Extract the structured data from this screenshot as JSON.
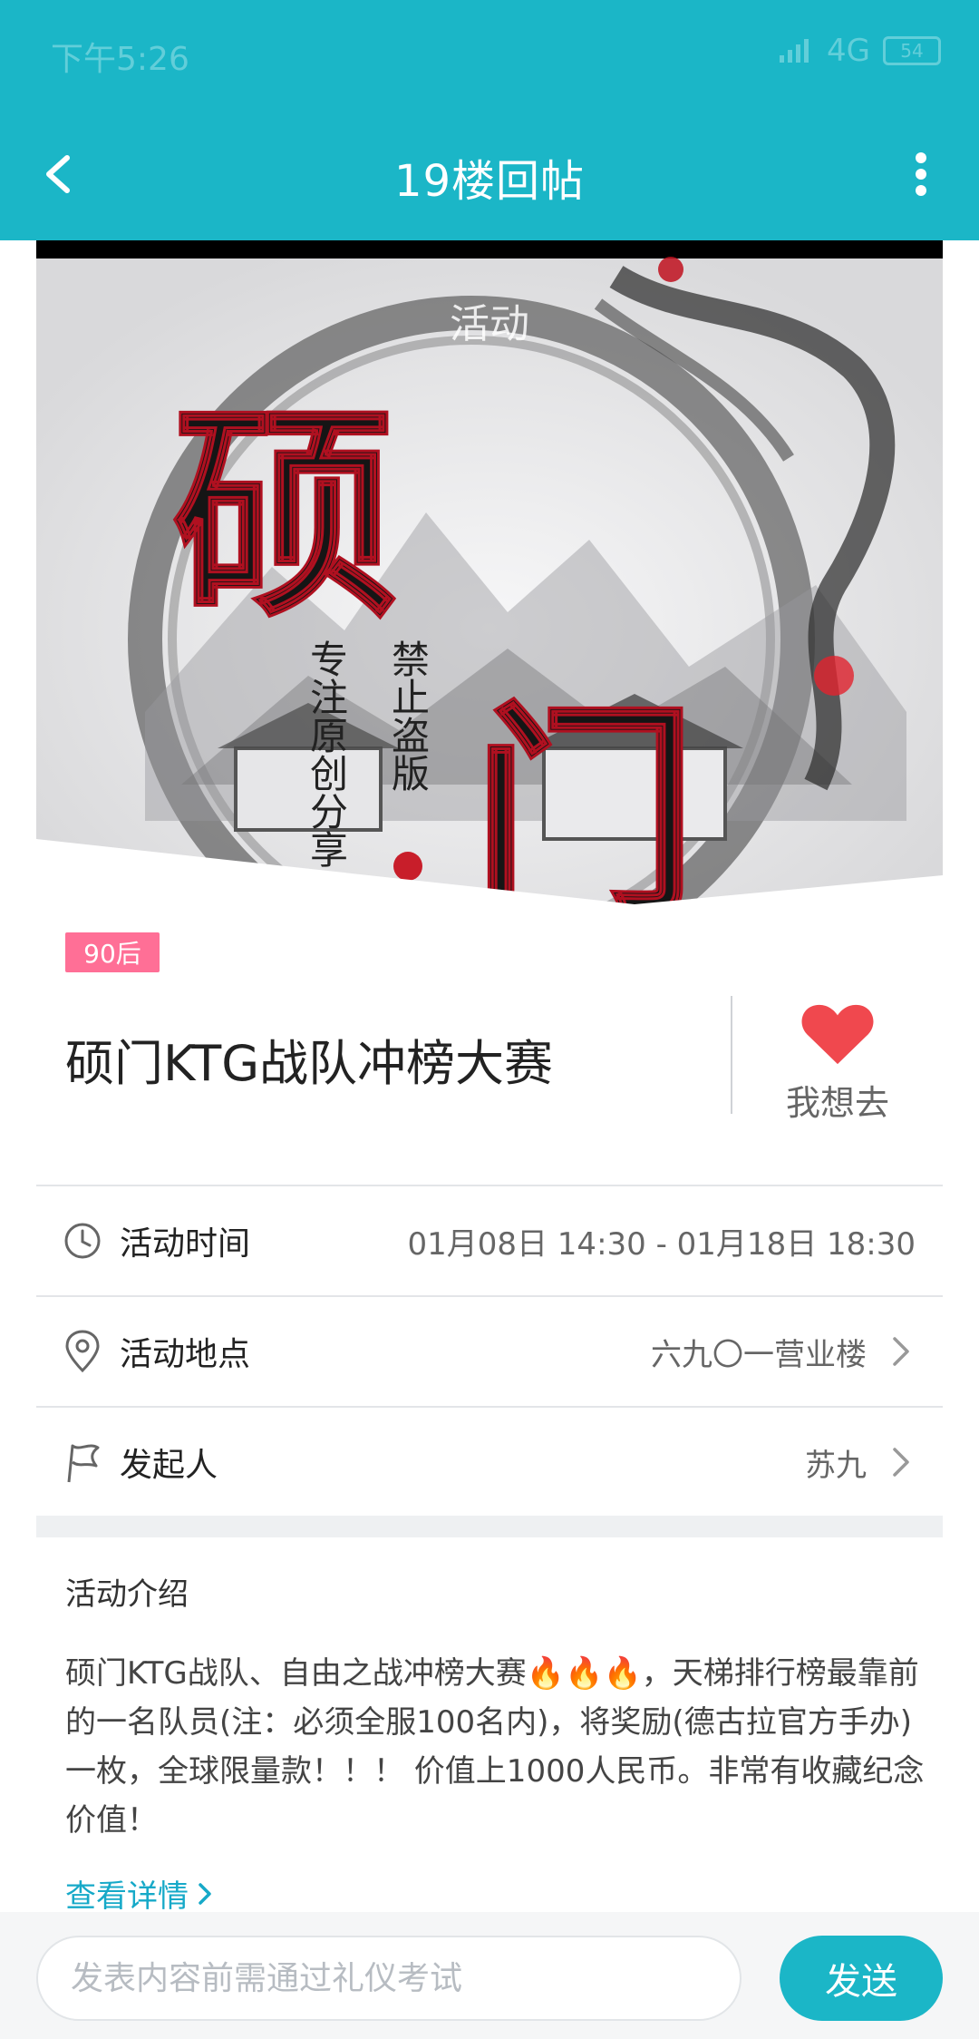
{
  "status": {
    "time": "下午5:26",
    "network": "4G",
    "battery": "54"
  },
  "header": {
    "title": "19楼回帖"
  },
  "hero": {
    "label": "活动"
  },
  "event": {
    "tag": "90后",
    "title": "硕门KTG战队冲榜大赛",
    "want_label": "我想去"
  },
  "info": {
    "time": {
      "label": "活动时间",
      "value": "01月08日 14:30 - 01月18日 18:30"
    },
    "location": {
      "label": "活动地点",
      "value": "六九〇一营业楼"
    },
    "organizer": {
      "label": "发起人",
      "value": "苏九"
    }
  },
  "intro": {
    "title": "活动介绍",
    "text": "硕门KTG战队、自由之战冲榜大赛🔥🔥🔥，天梯排行榜最靠前的一名队员(注：必须全服100名内)，将奖励(德古拉官方手办)一枚，全球限量款！！！ 价值上1000人民币。非常有收藏纪念价值！",
    "more_link": "查看详情"
  },
  "composer": {
    "placeholder": "发表内容前需通过礼仪考试",
    "send_label": "发送"
  },
  "colors": {
    "accent": "#1bb6c7",
    "heart": "#f0484e",
    "tag": "#ff6f96",
    "link": "#16a9c8"
  }
}
